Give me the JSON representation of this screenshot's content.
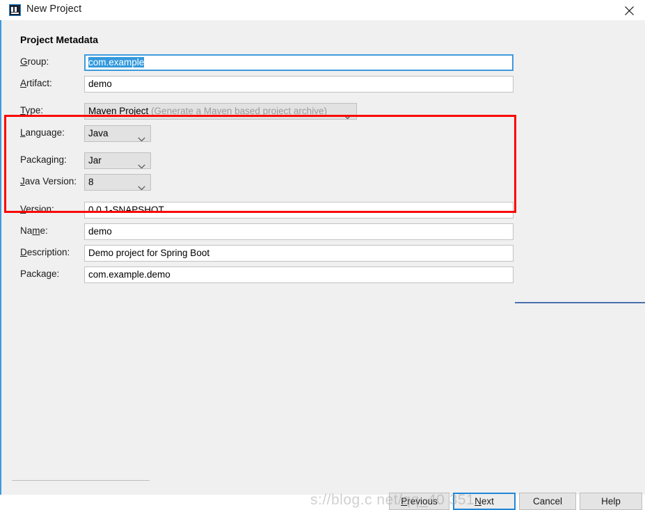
{
  "window": {
    "title": "New Project",
    "app_icon": "intellij-idea-icon",
    "close_icon": "close-icon"
  },
  "dialog": {
    "section_title": "Project Metadata",
    "fields": [
      {
        "label": "Group:",
        "mnemonic": "G",
        "value": "com.example",
        "type": "text",
        "focused": true,
        "selected": true
      },
      {
        "label": "Artifact:",
        "mnemonic": "A",
        "value": "demo",
        "type": "text",
        "focused": false,
        "selected": false
      },
      {
        "label": "Version:",
        "mnemonic": "V",
        "value": "0.0.1-SNAPSHOT",
        "type": "text",
        "focused": false,
        "selected": false
      },
      {
        "label": "Name:",
        "mnemonic": "m",
        "value": "demo",
        "type": "text",
        "focused": false,
        "selected": false
      },
      {
        "label": "Description:",
        "mnemonic": "D",
        "value": "Demo project for Spring Boot",
        "type": "text",
        "focused": false,
        "selected": false
      },
      {
        "label": "Package:",
        "mnemonic": "g",
        "value": "com.example.demo",
        "type": "text",
        "focused": false,
        "selected": false
      }
    ],
    "combos": [
      {
        "label": "Type:",
        "mnemonic": "T",
        "value": "Maven Project",
        "hint": "(Generate a Maven based project archive)"
      },
      {
        "label": "Language:",
        "mnemonic": "L",
        "value": "Java",
        "hint": ""
      },
      {
        "label": "Packaging:",
        "mnemonic": "",
        "value": "Jar",
        "hint": ""
      },
      {
        "label": "Java Version:",
        "mnemonic": "J",
        "value": "8",
        "hint": ""
      }
    ],
    "chevron_icon": "chevron-down-icon"
  },
  "buttons": {
    "previous": "Previous",
    "next": "Next",
    "cancel": "Cancel",
    "help": "Help"
  },
  "annotation": {
    "highlight_color": "#fb0404"
  },
  "watermark": {
    "text": "s://blog.c   net/qq_40      351"
  }
}
